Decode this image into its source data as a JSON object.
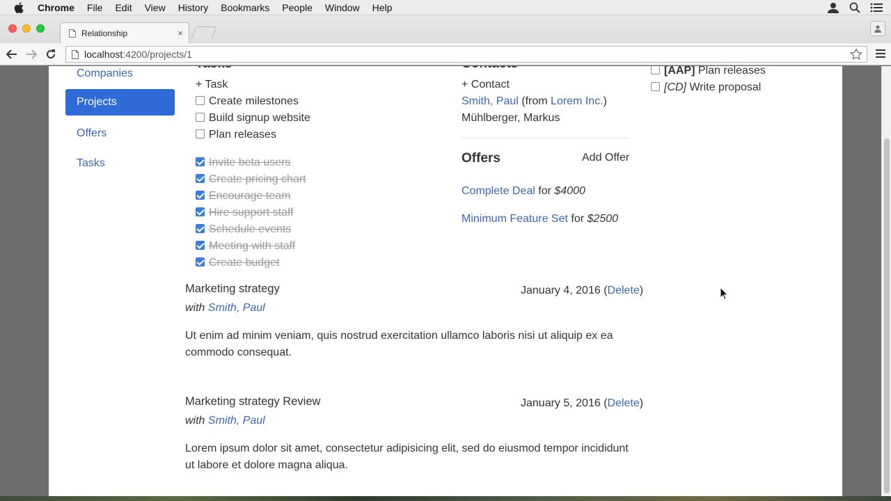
{
  "menubar": {
    "app": "Chrome",
    "items": [
      "File",
      "Edit",
      "View",
      "History",
      "Bookmarks",
      "People",
      "Window",
      "Help"
    ]
  },
  "tab": {
    "title": "Relationship",
    "close": "×"
  },
  "omnibox": {
    "url_host": "localhost",
    "url_path": ":4200/projects/1"
  },
  "sidebar": {
    "items": [
      {
        "label": "Companies"
      },
      {
        "label": "Projects",
        "active": true
      },
      {
        "label": "Offers"
      },
      {
        "label": "Tasks"
      }
    ]
  },
  "tasks": {
    "heading": "Tasks",
    "add_label": "+ Task",
    "open": [
      "Create milestones",
      "Build signup website",
      "Plan releases"
    ],
    "done": [
      "Invite beta users",
      "Create pricing chart",
      "Encourage team",
      "Hire support staff",
      "Schedule events",
      "Meeting with staff",
      "Create budget"
    ]
  },
  "contacts": {
    "heading": "Contacts",
    "add_label": "+ Contact",
    "items": [
      {
        "name": "Smith, Paul",
        "from_prefix": "(from ",
        "company": "Lorem Inc.",
        "from_suffix": ")"
      },
      {
        "name": "Mühlberger, Markus"
      }
    ]
  },
  "offers": {
    "heading": "Offers",
    "add_label": "Add Offer",
    "items": [
      {
        "name": "Complete Deal",
        "for": "for",
        "amount": "$4000"
      },
      {
        "name": "Minimum Feature Set",
        "for": "for",
        "amount": "$2500"
      }
    ]
  },
  "related_tasks": [
    {
      "code": "[AAP]",
      "label": "Plan releases"
    },
    {
      "code": "[CD]",
      "label": "Write proposal"
    }
  ],
  "notes": [
    {
      "title": "Marketing strategy",
      "date": "January 4, 2016",
      "delete_label": "Delete",
      "with_label": "with",
      "contact": "Smith, Paul",
      "body_line1": "Ut enim ad minim veniam, quis nostrud exercitation ullamco laboris nisi ut aliquip ex ea",
      "body_line2": "commodo consequat."
    },
    {
      "title": "Marketing strategy Review",
      "date": "January 5, 2016",
      "delete_label": "Delete",
      "with_label": "with",
      "contact": "Smith, Paul",
      "body_line1": "Lorem ipsum dolor sit amet, consectetur adipisicing elit, sed do eiusmod tempor incididunt",
      "body_line2": "ut labore et dolore magna aliqua."
    }
  ]
}
